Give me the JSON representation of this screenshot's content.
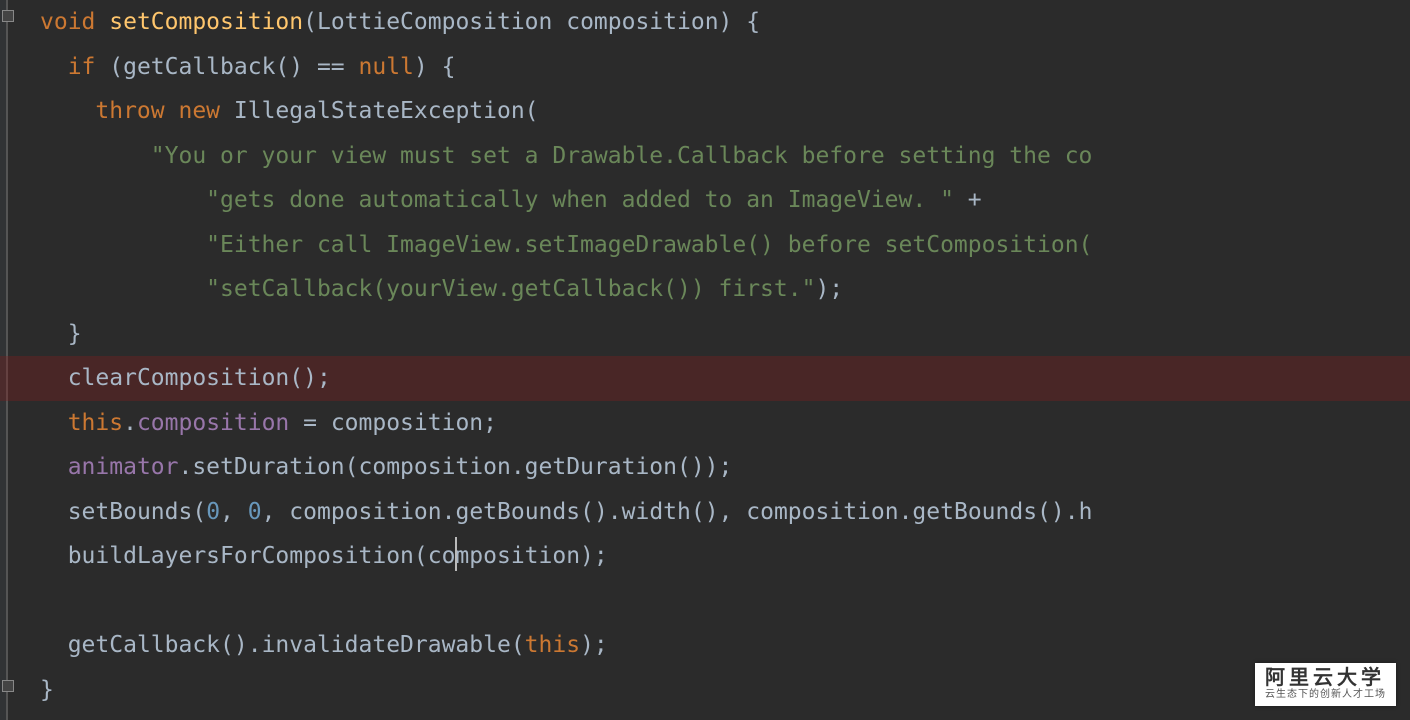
{
  "code": {
    "line1_kw": "void",
    "line1_method": "setComposition",
    "line1_params": "(LottieComposition composition) {",
    "line2_kwif": "if",
    "line2_open": " (getCallback() == ",
    "line2_null": "null",
    "line2_close": ") {",
    "line3_throw": "throw",
    "line3_new": " new ",
    "line3_exc": "IllegalStateException(",
    "line4_str": "\"You or your view must set a Drawable.Callback before setting the co",
    "line5_str": "\"gets done automatically when added to an ImageView. \"",
    "line5_plus": " +",
    "line6_str": "\"Either call ImageView.setImageDrawable() before setComposition(",
    "line7_str": "\"setCallback(yourView.getCallback()) first.\"",
    "line7_close": ");",
    "line8_close": "}",
    "line9_call": "clearComposition();",
    "line10_this": "this",
    "line10_dotfield": ".",
    "line10_field": "composition",
    "line10_assign": " = composition;",
    "line11_field": "animator",
    "line11_call": ".setDuration(composition.getDuration());",
    "line12_call_a": "setBounds(",
    "line12_zero1": "0",
    "line12_comma1": ", ",
    "line12_zero2": "0",
    "line12_rest": ", composition.getBounds().width(), composition.getBounds().h",
    "line13_call": "buildLayersForComposition(composition);",
    "line14_blank": "",
    "line15_call_a": "getCallback().invalidateDrawable(",
    "line15_this": "this",
    "line15_close": ");",
    "line16_close": "}"
  },
  "watermark": {
    "title": "阿里云大学",
    "subtitle": "云生态下的创新人才工场"
  },
  "cursor_line": 13,
  "changed_line_deleted": 9
}
